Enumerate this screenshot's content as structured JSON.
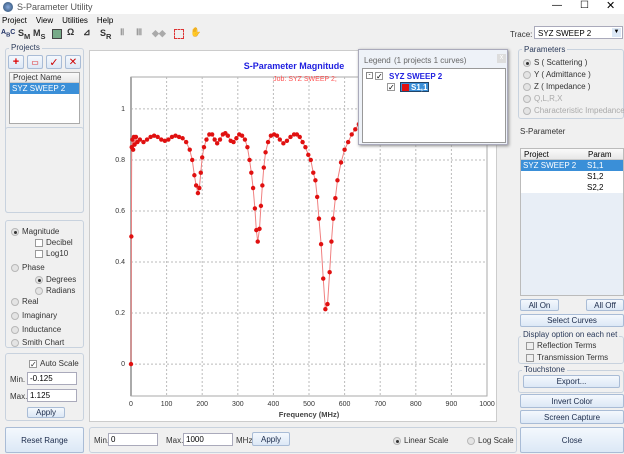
{
  "window": {
    "title": "S-Parameter Utility"
  },
  "menu": [
    "Project",
    "View",
    "Utilities",
    "Help"
  ],
  "toolbar": {
    "icons": [
      "abc-icon",
      "sm-icon",
      "ms-icon",
      "calc-icon",
      "omega-icon",
      "chart-icon",
      "sr-icon",
      "align-icon",
      "align2-icon",
      "arrows-icon",
      "select-icon",
      "hand-icon"
    ]
  },
  "projects": {
    "title": "Projects",
    "column": "Project Name",
    "items": [
      "SYZ SWEEP 2"
    ]
  },
  "display": {
    "magnitude": "Magnitude",
    "decibel": "Decibel",
    "log10": "Log10",
    "phase": "Phase",
    "degrees": "Degrees",
    "radians": "Radians",
    "real": "Real",
    "imaginary": "Imaginary",
    "inductance": "Inductance",
    "smith": "Smith Chart",
    "selected": "Magnitude"
  },
  "scale": {
    "auto_label": "Auto Scale",
    "auto": true,
    "min_label": "Min.",
    "min": "-0.125",
    "max_label": "Max.",
    "max": "1.125",
    "apply": "Apply"
  },
  "reset": "Reset Range",
  "range": {
    "min_label": "Min.",
    "min": "0",
    "max_label": "Max.",
    "max": "1000",
    "unit": "MHz",
    "apply": "Apply",
    "linear": "Linear Scale",
    "log": "Log Scale",
    "selected": "Linear Scale"
  },
  "trace": {
    "label": "Trace:",
    "value": "SYZ SWEEP 2"
  },
  "parameters": {
    "title": "Parameters",
    "s": "S ( Scattering )",
    "y": "Y ( Admittance )",
    "z": "Z ( Impedance )",
    "q": "Q,L,R,X",
    "c": "Characteristic Impedance",
    "selected": "S ( Scattering )"
  },
  "sparam": {
    "title": "S-Parameter",
    "cols": [
      "Project",
      "Param"
    ],
    "rows": [
      [
        "SYZ SWEEP 2",
        "S1,1"
      ],
      [
        "",
        "S1,2"
      ],
      [
        "",
        "S2,2"
      ]
    ]
  },
  "buttons": {
    "all_on": "All On",
    "all_off": "All Off",
    "select": "Select Curves",
    "export": "Export...",
    "invert": "Invert Color",
    "capture": "Screen Capture",
    "close": "Close"
  },
  "netopt": {
    "title": "Display option on each net",
    "refl": "Reflection Terms",
    "trans": "Transmission Terms"
  },
  "touchstone": {
    "title": "Touchstone"
  },
  "legend": {
    "title": "Legend",
    "info": "(1 projects 1 curves)",
    "project": "SYZ SWEEP 2",
    "curve": "S1,1"
  },
  "colors": {
    "curve": "#e01010",
    "title": "#2020e0",
    "job": "#ff5050",
    "select": "#3a8fd8"
  },
  "chart_data": {
    "type": "line",
    "title": "S-Parameter Magnitude",
    "subtitle": "Job:  SYZ SWEEP 2;",
    "xlabel": "Frequency (MHz)",
    "ylabel": "",
    "xlim": [
      0,
      1000
    ],
    "ylim": [
      -0.125,
      1.125
    ],
    "grid": true,
    "xticks": [
      "0",
      "100",
      "200",
      "300",
      "400",
      "500",
      "600",
      "700",
      "800",
      "900",
      "1000"
    ],
    "yticks": [
      "0",
      "0.2",
      "0.4",
      "0.6",
      "0.8",
      "1"
    ],
    "series": [
      {
        "points": [
          [
            0,
            0
          ],
          [
            1,
            0.5
          ],
          [
            2,
            0.85
          ],
          [
            4,
            0.88
          ],
          [
            6,
            0.84
          ],
          [
            8,
            0.89
          ],
          [
            10,
            0.86
          ],
          [
            14,
            0.89
          ],
          [
            18,
            0.87
          ],
          [
            25,
            0.88
          ],
          [
            35,
            0.87
          ],
          [
            45,
            0.88
          ],
          [
            55,
            0.89
          ],
          [
            65,
            0.895
          ],
          [
            75,
            0.89
          ],
          [
            85,
            0.88
          ],
          [
            95,
            0.875
          ],
          [
            105,
            0.88
          ],
          [
            115,
            0.89
          ],
          [
            125,
            0.895
          ],
          [
            135,
            0.89
          ],
          [
            145,
            0.885
          ],
          [
            155,
            0.87
          ],
          [
            165,
            0.84
          ],
          [
            172,
            0.8
          ],
          [
            178,
            0.74
          ],
          [
            183,
            0.7
          ],
          [
            188,
            0.67
          ],
          [
            192,
            0.69
          ],
          [
            196,
            0.75
          ],
          [
            200,
            0.81
          ],
          [
            205,
            0.85
          ],
          [
            212,
            0.88
          ],
          [
            220,
            0.9
          ],
          [
            228,
            0.9
          ],
          [
            235,
            0.88
          ],
          [
            242,
            0.865
          ],
          [
            250,
            0.88
          ],
          [
            258,
            0.9
          ],
          [
            265,
            0.905
          ],
          [
            272,
            0.895
          ],
          [
            280,
            0.875
          ],
          [
            288,
            0.87
          ],
          [
            296,
            0.885
          ],
          [
            304,
            0.9
          ],
          [
            312,
            0.895
          ],
          [
            320,
            0.88
          ],
          [
            327,
            0.85
          ],
          [
            333,
            0.8
          ],
          [
            338,
            0.75
          ],
          [
            343,
            0.69
          ],
          [
            348,
            0.61
          ],
          [
            352,
            0.525
          ],
          [
            356,
            0.48
          ],
          [
            361,
            0.53
          ],
          [
            365,
            0.62
          ],
          [
            369,
            0.7
          ],
          [
            373,
            0.77
          ],
          [
            378,
            0.83
          ],
          [
            385,
            0.87
          ],
          [
            393,
            0.895
          ],
          [
            402,
            0.9
          ],
          [
            410,
            0.895
          ],
          [
            418,
            0.88
          ],
          [
            428,
            0.865
          ],
          [
            438,
            0.875
          ],
          [
            448,
            0.89
          ],
          [
            458,
            0.9
          ],
          [
            466,
            0.9
          ],
          [
            474,
            0.89
          ],
          [
            482,
            0.87
          ],
          [
            490,
            0.85
          ],
          [
            498,
            0.82
          ],
          [
            505,
            0.8
          ],
          [
            512,
            0.75
          ],
          [
            518,
            0.72
          ],
          [
            523,
            0.655
          ],
          [
            528,
            0.57
          ],
          [
            534,
            0.47
          ],
          [
            540,
            0.335
          ],
          [
            546,
            0.215
          ],
          [
            552,
            0.235
          ],
          [
            558,
            0.36
          ],
          [
            563,
            0.48
          ],
          [
            568,
            0.57
          ],
          [
            574,
            0.65
          ],
          [
            580,
            0.72
          ],
          [
            590,
            0.79
          ],
          [
            600,
            0.84
          ],
          [
            610,
            0.87
          ],
          [
            620,
            0.9
          ],
          [
            630,
            0.92
          ],
          [
            640,
            0.94
          ]
        ]
      }
    ]
  }
}
